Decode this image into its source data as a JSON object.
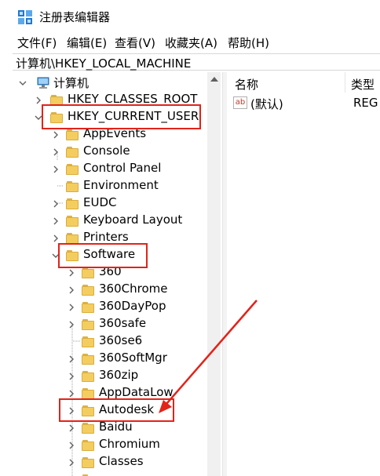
{
  "window": {
    "title": "注册表编辑器"
  },
  "menu": {
    "items": [
      "文件(F)",
      "编辑(E)",
      "查看(V)",
      "收藏夹(A)",
      "帮助(H)"
    ]
  },
  "address": {
    "path": "计算机\\HKEY_LOCAL_MACHINE"
  },
  "tree": {
    "root": "计算机",
    "hive_classes_root": "HKEY_CLASSES_ROOT",
    "hive_current_user": "HKEY_CURRENT_USER",
    "hkcu_children": [
      "AppEvents",
      "Console",
      "Control Panel",
      "Environment",
      "EUDC",
      "Keyboard Layout",
      "Printers",
      "Software"
    ],
    "software_children": [
      "360",
      "360Chrome",
      "360DayPop",
      "360safe",
      "360se6",
      "360SoftMgr",
      "360zip",
      "AppDataLow",
      "Autodesk",
      "Baidu",
      "Chromium",
      "Classes"
    ]
  },
  "values_pane": {
    "headers": {
      "name": "名称",
      "type": "类型"
    },
    "rows": [
      {
        "icon": "ab",
        "name": "(默认)",
        "type": "REG"
      }
    ]
  },
  "colors": {
    "highlight": "#e2231a",
    "folder": "#f4cd61"
  }
}
